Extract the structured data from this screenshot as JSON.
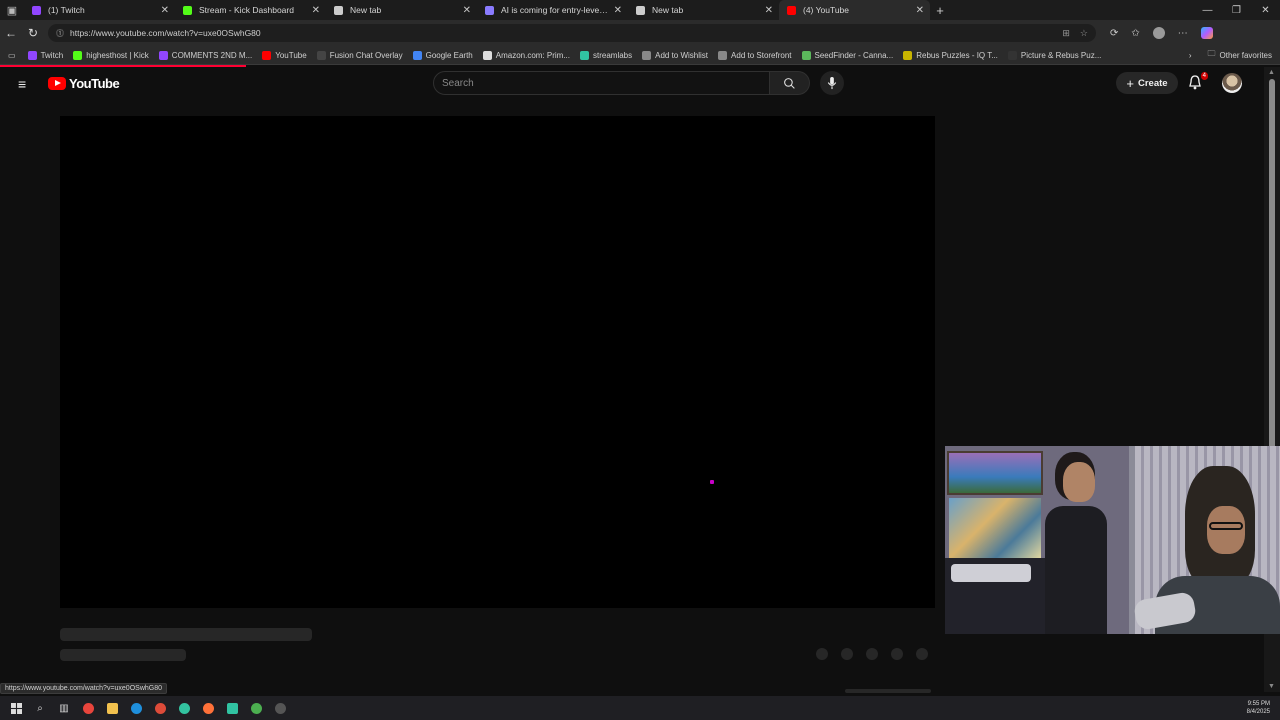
{
  "browser": {
    "tabs": [
      {
        "title": "(1) Twitch",
        "color": "#9146ff",
        "active": false
      },
      {
        "title": "Stream - Kick Dashboard",
        "color": "#53fc18",
        "active": false
      },
      {
        "title": "New tab",
        "color": "#cccccc",
        "active": false
      },
      {
        "title": "AI is coming for entry-level jobs.",
        "color": "#8a7bff",
        "active": false
      },
      {
        "title": "New tab",
        "color": "#cccccc",
        "active": false
      },
      {
        "title": "(4) YouTube",
        "color": "#ff0000",
        "active": true
      }
    ],
    "url": "https://www.youtube.com/watch?v=uxe0OSwhG80",
    "bookmarks": [
      {
        "label": "Twitch",
        "color": "#9146ff"
      },
      {
        "label": "highesthost | Kick",
        "color": "#53fc18"
      },
      {
        "label": "COMMENTS 2ND M...",
        "color": "#9146ff"
      },
      {
        "label": "YouTube",
        "color": "#ff0000"
      },
      {
        "label": "Fusion Chat Overlay",
        "color": "#444444"
      },
      {
        "label": "Google Earth",
        "color": "#4285f4"
      },
      {
        "label": "Amazon.com: Prim...",
        "color": "#dddddd"
      },
      {
        "label": "streamlabs",
        "color": "#31c3a2"
      },
      {
        "label": "Add to Wishlist",
        "color": "#888888"
      },
      {
        "label": "Add to Storefront",
        "color": "#888888"
      },
      {
        "label": "SeedFinder - Canna...",
        "color": "#5cb85c"
      },
      {
        "label": "Rebus Puzzles - IQ T...",
        "color": "#c8b400"
      },
      {
        "label": "Picture & Rebus Puz...",
        "color": "#333333"
      }
    ],
    "other_favorites": "Other favorites",
    "status_url": "https://www.youtube.com/watch?v=uxe0OSwhG80"
  },
  "youtube": {
    "logo_text": "YouTube",
    "search_placeholder": "Search",
    "create_label": "Create",
    "notification_count": "4"
  },
  "taskbar": {
    "time": "9:55 PM",
    "date": "8/4/2025"
  }
}
